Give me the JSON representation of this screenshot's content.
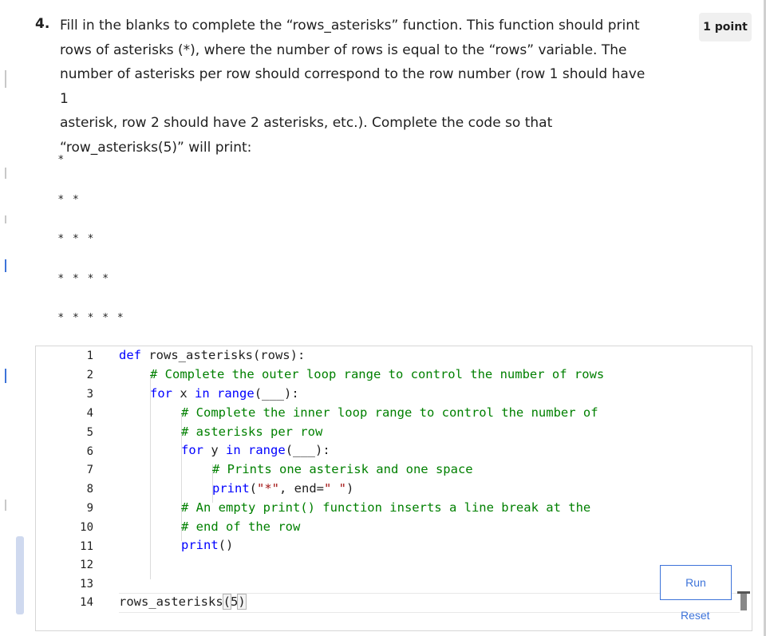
{
  "question": {
    "number": "4.",
    "text_lines": [
      "Fill in the blanks to complete the “rows_asterisks” function. This function should print",
      "rows of asterisks (*), where the number of rows is equal to the “rows” variable. The",
      "number of asterisks per row should correspond to the row number (row 1 should have 1",
      "asterisk, row 2 should have 2 asterisks, etc.). Complete the code so that",
      "“row_asterisks(5)” will print:"
    ],
    "points": "1 point",
    "output_rows": [
      "*",
      "* *",
      "* * *",
      "* * * *",
      "* * * * *"
    ]
  },
  "editor": {
    "line_numbers": [
      "1",
      "2",
      "3",
      "4",
      "5",
      "6",
      "7",
      "8",
      "9",
      "10",
      "11",
      "12",
      "13",
      "14"
    ],
    "code": {
      "l1_kw": "def",
      "l1_rest": " rows_asterisks(rows):",
      "l2_cm": "# Complete the outer loop range to control the number of rows",
      "l3_kw1": "for",
      "l3_mid": " x ",
      "l3_kw2": "in",
      "l3_sp": " ",
      "l3_fn": "range",
      "l3_rest": "(___):",
      "l4_cm": "# Complete the inner loop range to control the number of",
      "l5_cm": "# asterisks per row",
      "l6_kw1": "for",
      "l6_mid": " y ",
      "l6_kw2": "in",
      "l6_sp": " ",
      "l6_fn": "range",
      "l6_rest": "(___):",
      "l7_cm": "# Prints one asterisk and one space",
      "l8_fn": "print",
      "l8_open": "(",
      "l8_str1": "\"*\"",
      "l8_mid": ", end=",
      "l8_str2": "\" \"",
      "l8_close": ")",
      "l9_cm": "# An empty print() function inserts a line break at the",
      "l10_cm": "# end of the row",
      "l11_fn": "print",
      "l11_rest": "()",
      "l14_name": "rows_asterisks",
      "l14_open": "(",
      "l14_arg": "5",
      "l14_close": ")"
    },
    "run_label": "Run",
    "reset_label": "Reset"
  },
  "colors": {
    "keyword": "#0000ff",
    "comment": "#008000",
    "string": "#a31515",
    "accent": "#3d73d9"
  }
}
